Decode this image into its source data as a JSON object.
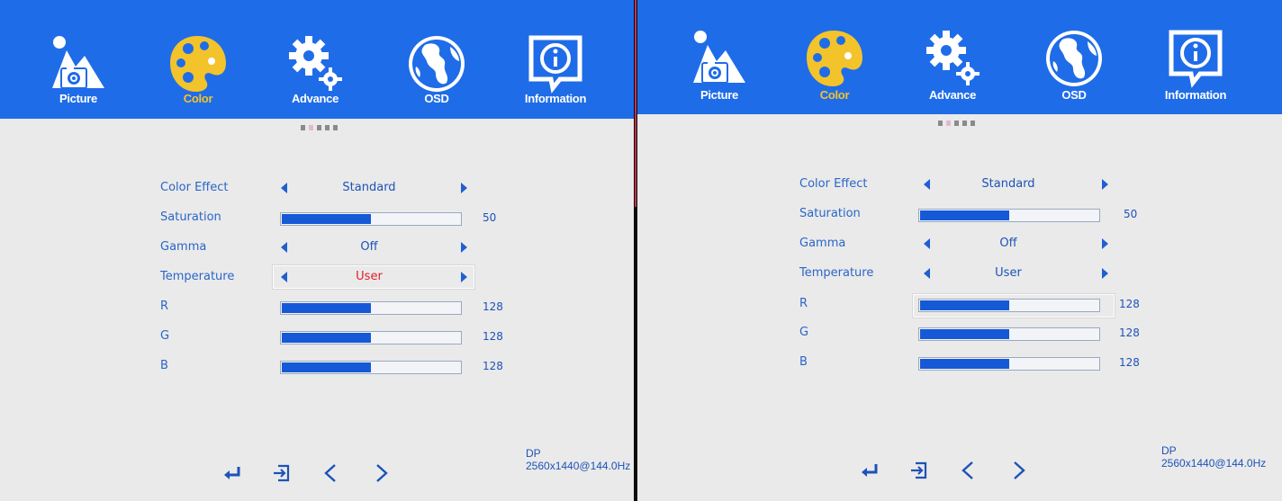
{
  "colors": {
    "topbar": "#1f6ce8",
    "active_tab_label": "#f3c32b",
    "text": "#2a66c8",
    "bar_fill": "#1659d6",
    "highlight_value": "#e0202a"
  },
  "panels": [
    {
      "tabs": [
        {
          "label": "Picture",
          "icon": "picture-icon",
          "active": false
        },
        {
          "label": "Color",
          "icon": "palette-icon",
          "active": true
        },
        {
          "label": "Advance",
          "icon": "gear-icon",
          "active": false
        },
        {
          "label": "OSD",
          "icon": "globe-icon",
          "active": false
        },
        {
          "label": "Information",
          "icon": "info-icon",
          "active": false
        }
      ],
      "settings": {
        "color_effect": {
          "label": "Color Effect",
          "value": "Standard"
        },
        "saturation": {
          "label": "Saturation",
          "value": "50"
        },
        "gamma": {
          "label": "Gamma",
          "value": "Off"
        },
        "temperature": {
          "label": "Temperature",
          "value": "User",
          "selected": true
        },
        "r": {
          "label": "R",
          "value": "128"
        },
        "g": {
          "label": "G",
          "value": "128"
        },
        "b": {
          "label": "B",
          "value": "128"
        }
      },
      "footer_icons": [
        "enter-icon",
        "exit-icon",
        "left-icon",
        "right-icon"
      ],
      "source": {
        "input": "DP",
        "mode": "2560x1440@144.0Hz"
      }
    },
    {
      "tabs": [
        {
          "label": "Picture",
          "icon": "picture-icon",
          "active": false
        },
        {
          "label": "Color",
          "icon": "palette-icon",
          "active": true
        },
        {
          "label": "Advance",
          "icon": "gear-icon",
          "active": false
        },
        {
          "label": "OSD",
          "icon": "globe-icon",
          "active": false
        },
        {
          "label": "Information",
          "icon": "info-icon",
          "active": false
        }
      ],
      "settings": {
        "color_effect": {
          "label": "Color Effect",
          "value": "Standard"
        },
        "saturation": {
          "label": "Saturation",
          "value": "50"
        },
        "gamma": {
          "label": "Gamma",
          "value": "Off"
        },
        "temperature": {
          "label": "Temperature",
          "value": "User"
        },
        "r": {
          "label": "R",
          "value": "128",
          "selected": true
        },
        "g": {
          "label": "G",
          "value": "128"
        },
        "b": {
          "label": "B",
          "value": "128"
        }
      },
      "footer_icons": [
        "enter-icon",
        "exit-icon",
        "left-icon",
        "right-icon"
      ],
      "source": {
        "input": "DP",
        "mode": "2560x1440@144.0Hz"
      }
    }
  ]
}
